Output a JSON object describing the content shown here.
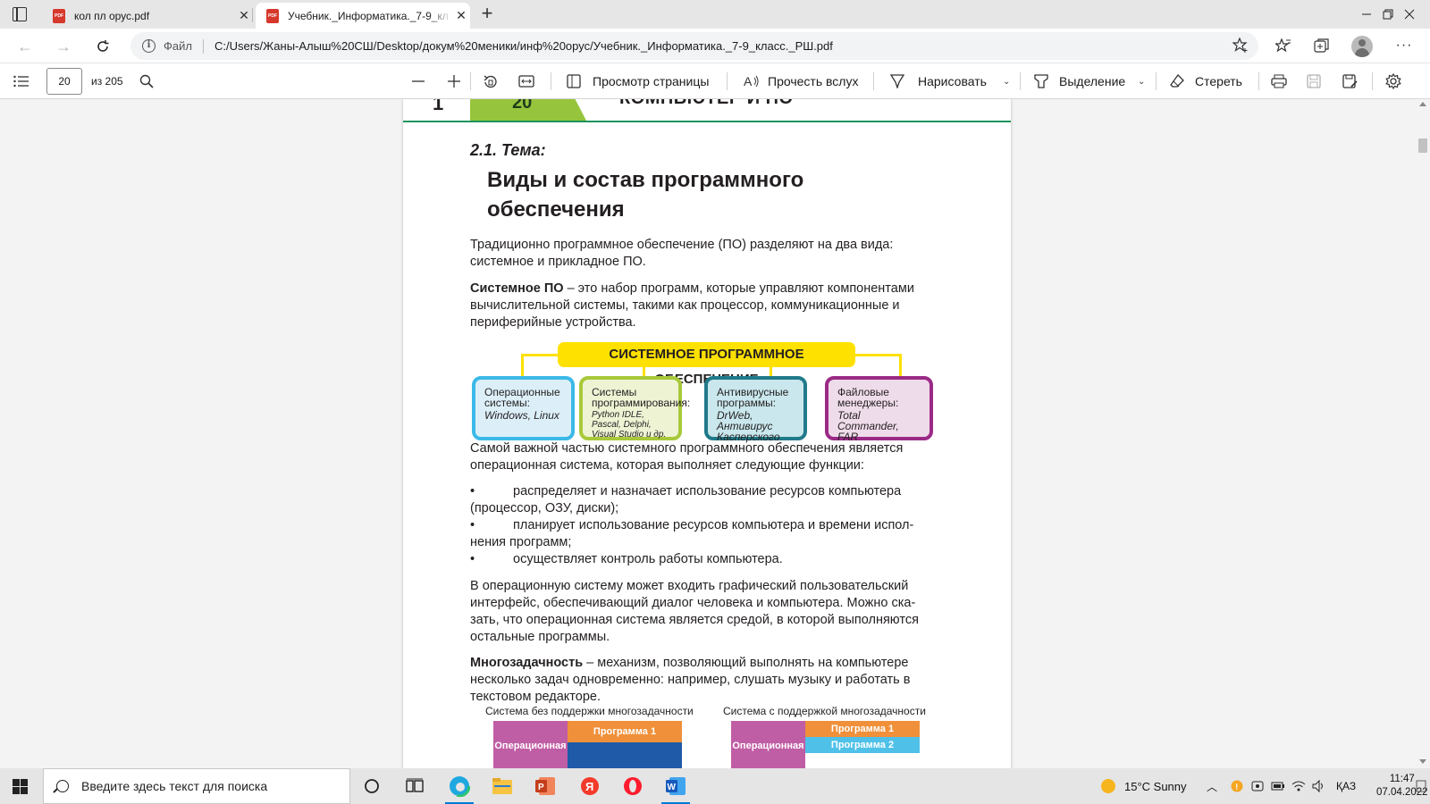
{
  "tabs": [
    {
      "title": "кол пл орус.pdf",
      "icon": "pdf-icon",
      "active": false
    },
    {
      "title": "Учебник._Информатика._7-9_кл",
      "icon": "pdf-icon",
      "active": true
    }
  ],
  "address": {
    "security_label": "Файл",
    "url": "C:/Users/Жаны-Алыш%20СШ/Desktop/докум%20меники/инф%20орус/Учебник._Информатика._7-9_класс._РШ.pdf"
  },
  "pdf_toolbar": {
    "page_current": "20",
    "page_total": "из 205",
    "page_view_label": "Просмотр страницы",
    "read_aloud_label": "Прочесть вслух",
    "draw_label": "Нарисовать",
    "highlight_label": "Выделение",
    "erase_label": "Стереть"
  },
  "document": {
    "header_chapter": "1",
    "header_page_num": "20",
    "header_title": "КОМПЬЮТЕР И ПО",
    "topic_label": "2.1. Тема:",
    "topic_title": "Виды и состав программного обеспечения",
    "para1": "Традиционно программное обеспечение (ПО) разделяют на два вида: системное и прикладное ПО.",
    "para2_bold": "Системное ПО",
    "para2_rest": " – это набор программ, которые управляют компонентами вычислительной системы, такими как процессор, коммуникационные и периферийные устройства.",
    "diagram": {
      "banner": "СИСТЕМНОЕ ПРОГРАММНОЕ ОБЕСПЕЧЕНИЕ",
      "categories": [
        {
          "title": "Операционные системы:",
          "examples": "Windows, Linux"
        },
        {
          "title": "Системы программирования:",
          "examples": "Python IDLE, Pascal, Delphi, Visual Studio и др."
        },
        {
          "title": "Антивирусные программы:",
          "examples": "DrWeb, Антивирус Касперского"
        },
        {
          "title": "Файловые менеджеры:",
          "examples": "Total Commander, FAR"
        }
      ]
    },
    "para3": "Самой важной частью системного программного обеспечения является операционная система, которая выполняет следующие функции:",
    "bullets": [
      "распределяет и назначает использование ресурсов компьютера (процессор, ОЗУ, диски);",
      "планирует использование ресурсов компьютера и времени испол-нения программ;",
      "осуществляет контроль работы компьютера."
    ],
    "para4": "В операционную систему может входить графический пользовательский интерфейс, обеспечивающий диалог человека и компьютера. Можно ска-зать, что операционная система является средой, в которой выполняются остальные программы.",
    "para5_bold": "Многозадачность",
    "para5_rest": " – механизм, позволяющий выполнять на компьютере несколько задач одновременно: например, слушать музыку и работать в текстовом редакторе.",
    "mini_left_caption": "Система без поддержки многозадачности",
    "mini_right_caption": "Система с поддержкой многозадачности",
    "mini_os_label": "Операционная",
    "mini_left_programs": [
      "Программа 1"
    ],
    "mini_right_programs": [
      "Программа 1",
      "Программа 2"
    ],
    "colors": {
      "green": "#96c53d",
      "yellow": "#ffe100",
      "purple_os": "#c05ea5",
      "orange": "#f0903a",
      "blue": "#1f5aa8",
      "lightblue": "#4fc1e9"
    }
  },
  "taskbar": {
    "search_placeholder": "Введите здесь текст для поиска",
    "weather": "15°C  Sunny",
    "lang": "ҚАЗ",
    "time": "11:47",
    "date": "07.04.2022"
  }
}
